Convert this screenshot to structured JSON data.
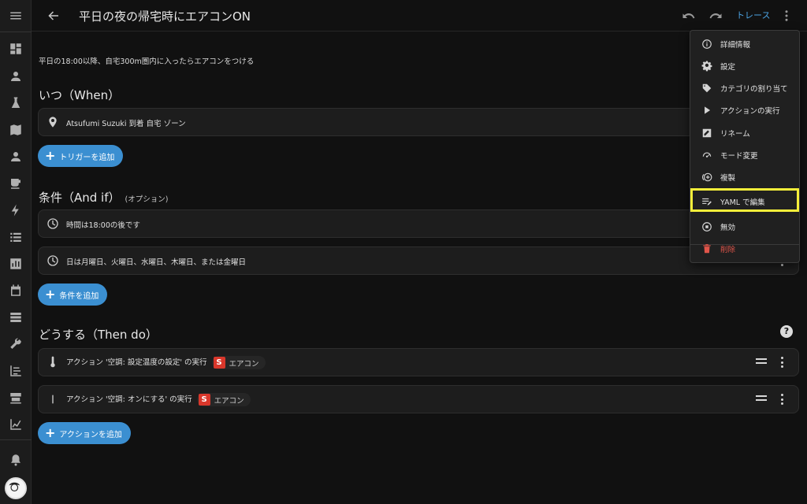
{
  "header": {
    "title": "平日の夜の帰宅時にエアコンON",
    "trace_label": "トレース"
  },
  "description": "平日の18:00以降、自宅300m圏内に入ったらエアコンをつける",
  "when": {
    "title": "いつ（When）",
    "triggers": [
      {
        "icon": "map-marker-icon",
        "text": "Atsufumi Suzuki 到着 自宅 ゾーン"
      }
    ],
    "add_label": "トリガーを追加"
  },
  "conditions": {
    "title": "条件（And if）",
    "optional": "(オプション)",
    "items": [
      {
        "icon": "clock-icon",
        "text": "時間は18:00の後です"
      },
      {
        "icon": "clock-icon",
        "text": "日は月曜日、火曜日、水曜日、木曜日、または金曜日"
      }
    ],
    "add_label": "条件を追加"
  },
  "actions": {
    "title": "どうする（Then do）",
    "items": [
      {
        "icon": "thermometer-icon",
        "text": "アクション '空調: 設定温度の設定' の実行",
        "chip": "エアコン",
        "chip_badge": "S"
      },
      {
        "icon": "power-icon",
        "text": "アクション '空調: オンにする' の実行",
        "chip": "エアコン",
        "chip_badge": "S"
      }
    ],
    "add_label": "アクションを追加"
  },
  "menu": {
    "items": [
      {
        "label": "詳細情報",
        "icon": "info-icon"
      },
      {
        "label": "設定",
        "icon": "gear-icon"
      },
      {
        "label": "カテゴリの割り当て",
        "icon": "tag-icon"
      },
      {
        "label": "アクションの実行",
        "icon": "play-icon"
      },
      {
        "label": "リネーム",
        "icon": "rename-icon"
      },
      {
        "label": "モード変更",
        "icon": "mode-icon"
      },
      {
        "label": "複製",
        "icon": "duplicate-icon"
      },
      {
        "label": "YAML で編集",
        "icon": "yaml-edit-icon"
      },
      {
        "label": "無効",
        "icon": "disable-icon"
      },
      {
        "label": "削除",
        "icon": "delete-icon"
      }
    ]
  },
  "colors": {
    "accent": "#3b8fd1",
    "highlight": "#f5ee3a",
    "danger": "#e0554a",
    "badge": "#d9372b"
  }
}
